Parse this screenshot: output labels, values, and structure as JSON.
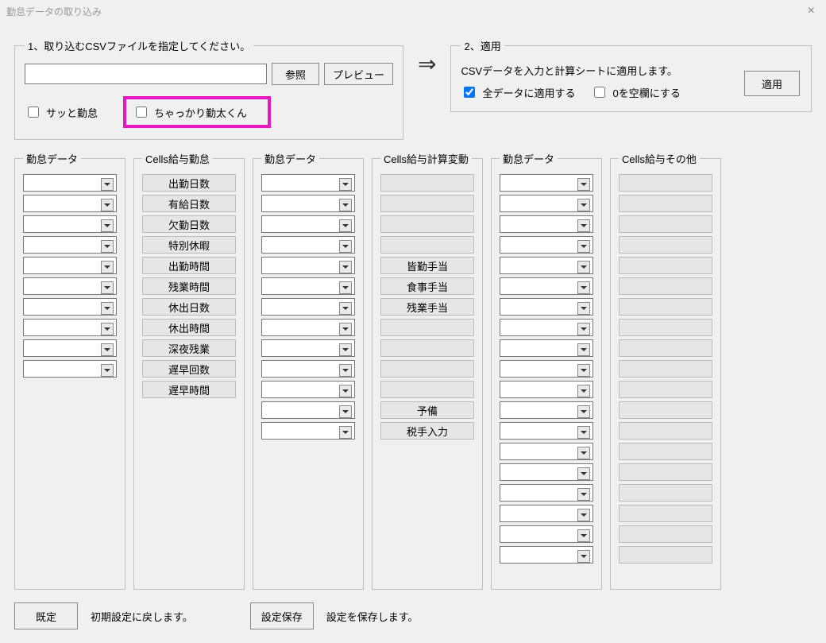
{
  "window": {
    "title": "勤怠データの取り込み"
  },
  "section1": {
    "legend": "1、取り込むCSVファイルを指定してください。",
    "file_value": "",
    "browse": "参照",
    "preview": "プレビュー",
    "chk_satto": "サッと勤怠",
    "chk_chakkari": "ちゃっかり勤太くん"
  },
  "arrow": "⇒",
  "section2": {
    "legend": "2、適用",
    "desc": "CSVデータを入力と計算シートに適用します。",
    "chk_all": "全データに適用する",
    "chk_zero": "0を空欄にする",
    "apply": "適用"
  },
  "columns": {
    "a": {
      "legend": "勤怠データ",
      "rows": 10
    },
    "b": {
      "legend": "Cells給与勤怠",
      "labels": [
        "出勤日数",
        "有給日数",
        "欠勤日数",
        "特別休暇",
        "出勤時間",
        "残業時間",
        "休出日数",
        "休出時間",
        "深夜残業",
        "遅早回数",
        "遅早時間"
      ]
    },
    "c": {
      "legend": "勤怠データ",
      "rows": 13
    },
    "d": {
      "legend": "Cells給与計算変動",
      "labels": [
        "",
        "",
        "",
        "",
        "皆勤手当",
        "食事手当",
        "残業手当",
        "",
        "",
        "",
        "",
        "予備",
        "税手入力"
      ]
    },
    "e": {
      "legend": "勤怠データ",
      "rows": 19
    },
    "f": {
      "legend": "Cells給与その他",
      "rows": 19
    }
  },
  "bottom": {
    "default_btn": "既定",
    "default_text": "初期設定に戻します。",
    "save_btn": "設定保存",
    "save_text": "設定を保存します。"
  }
}
